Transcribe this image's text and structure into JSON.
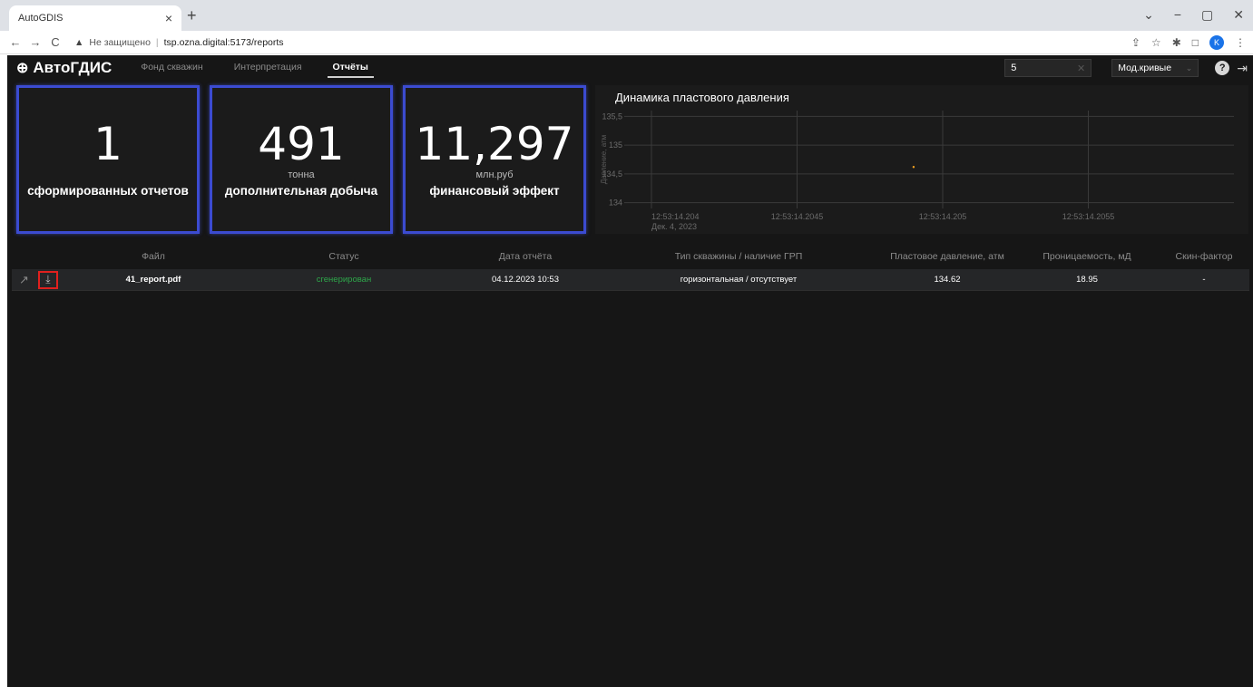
{
  "browser": {
    "tab_title": "AutoGDIS",
    "tab_close": "×",
    "new_tab": "+",
    "insecure_label": "Не защищено",
    "url": "tsp.ozna.digital:5173/reports",
    "profile_initial": "K",
    "win_min": "−",
    "win_max": "▢",
    "win_close": "✕",
    "win_tabs": "⌄"
  },
  "app": {
    "logo_text": "АвтоГДИС",
    "nav": [
      {
        "label": "Фонд скважин"
      },
      {
        "label": "Интерпретация"
      },
      {
        "label": "Отчёты"
      }
    ],
    "well_input_value": "5",
    "mode_select_value": "Мод.кривые",
    "help": "?"
  },
  "kpis": [
    {
      "value": "1",
      "unit": "",
      "caption": "сформированных отчетов"
    },
    {
      "value": "491",
      "unit": "тонна",
      "caption": "дополнительная добыча"
    },
    {
      "value": "11,297",
      "unit": "млн.руб",
      "caption": "финансовый эффект"
    }
  ],
  "chart_data": {
    "type": "scatter",
    "title": "Динамика пластового давления",
    "ylabel": "Давление, атм",
    "xlabel": "",
    "y_ticks": [
      "134",
      "134,5",
      "135",
      "135,5"
    ],
    "x_ticks": [
      "12:53:14.204",
      "12:53:14.2045",
      "12:53:14.205",
      "12:53:14.2055"
    ],
    "x_date_label": "Дек. 4, 2023",
    "ylim": [
      133.9,
      135.6
    ],
    "xlim": [
      12.53142035,
      12.5314206
    ],
    "points": [
      {
        "x": 12.5314205,
        "y": 134.62
      }
    ],
    "point_color": "#f0a020",
    "grid": true
  },
  "table": {
    "headers": [
      "Файл",
      "Статус",
      "Дата отчёта",
      "Тип скважины / наличие ГРП",
      "Пластовое давление, атм",
      "Проницаемость, мД",
      "Скин-фактор"
    ],
    "rows": [
      {
        "file": "41_report.pdf",
        "status": "сгенерирован",
        "date": "04.12.2023 10:53",
        "type": "горизонтальная / отсутствует",
        "pressure": "134.62",
        "permeability": "18.95",
        "skin": "-"
      }
    ]
  }
}
